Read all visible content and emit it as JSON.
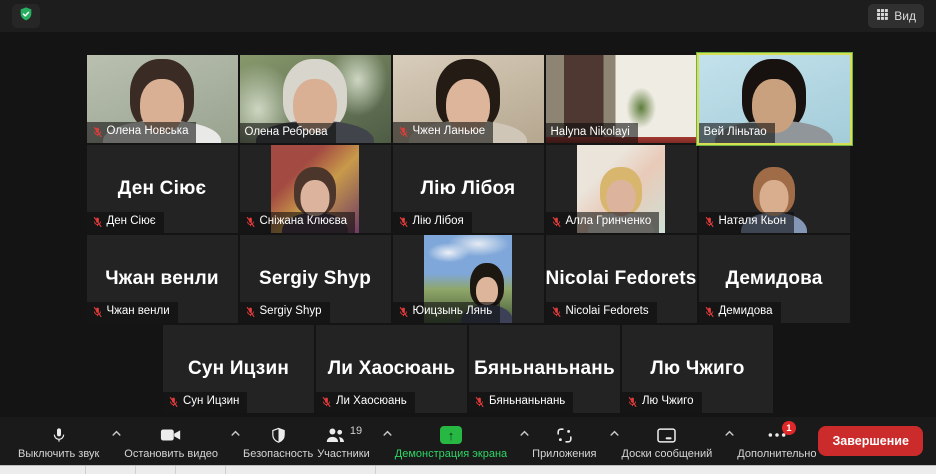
{
  "topbar": {
    "security_icon": "shield-check-icon",
    "view_label": "Вид"
  },
  "meeting": {
    "rows": [
      5,
      5,
      5,
      4
    ],
    "participants": [
      {
        "name": "Олена Новська",
        "tile": "video",
        "muted": true,
        "active": false,
        "variant": "plain",
        "person": "close",
        "colors": {
          "c1": "#b9c0b0",
          "c2": "#99a28f",
          "hair": "#3a2c24",
          "skin": "#d9b094",
          "shirt": "#e9e9e7"
        }
      },
      {
        "name": "Олена Реброва",
        "tile": "video",
        "muted": false,
        "active": false,
        "variant": "blur",
        "person": "close",
        "colors": {
          "c1": "#87996c",
          "c2": "#4e5c45",
          "c3": "#cdd6c2",
          "hair": "#d8d5cd",
          "skin": "#d9b094",
          "shirt": "#41454b"
        }
      },
      {
        "name": "Чжен Ланьюе",
        "tile": "video",
        "muted": true,
        "active": false,
        "variant": "plain",
        "person": "close",
        "colors": {
          "c1": "#d8cdbb",
          "c2": "#b5a78f",
          "hair": "#241b14",
          "skin": "#dcb59a",
          "shirt": "#cfc6b8"
        }
      },
      {
        "name": "Halyna Nikolayi",
        "tile": "video",
        "muted": false,
        "active": false,
        "variant": "room",
        "person": false,
        "colors": {
          "c1": "#8d8474",
          "c2": "#4e3831",
          "c3": "#efece3",
          "c4": "#5d7c3b"
        }
      },
      {
        "name": "Вей Ліньтао",
        "tile": "video",
        "muted": false,
        "active": true,
        "variant": "plain",
        "person": "close",
        "colors": {
          "c1": "#c3e2ec",
          "c2": "#a3ccd9",
          "hair": "#17120f",
          "skin": "#c9a17f",
          "shirt": "#90969a"
        }
      },
      {
        "name": "Ден Сіює",
        "tile": "text",
        "muted": true,
        "active": false
      },
      {
        "name": "Сніжана Клюєва",
        "tile": "photo",
        "muted": true,
        "active": false,
        "variant": "portrait",
        "person": "center",
        "colors": {
          "c1": "#a34a42",
          "c2": "#c89a4a",
          "c3": "#6e3b63",
          "hair": "#4c352a",
          "skin": "#dcb49d",
          "shirt": "#473747"
        }
      },
      {
        "name": "Лію Лібоя",
        "tile": "text",
        "muted": true,
        "active": false
      },
      {
        "name": "Алла Гринченко",
        "tile": "photo",
        "muted": true,
        "active": false,
        "variant": "portrait",
        "person": "center",
        "colors": {
          "c1": "#eae4da",
          "c2": "#e9cab8",
          "c3": "#cfe0d4",
          "hair": "#d9b66e",
          "skin": "#dcb49d",
          "shirt": "#e7e4dc"
        }
      },
      {
        "name": "Наталя Кьон",
        "tile": "photo",
        "muted": true,
        "active": false,
        "variant": "sea",
        "person": "center",
        "colors": {
          "c1": "#b9c0c6",
          "c2": "#95a0ab",
          "c3": "#55603f",
          "hair": "#a06c48",
          "skin": "#d9ae8e",
          "shirt": "#8396b5"
        }
      },
      {
        "name": "Чжан венли",
        "tile": "text",
        "muted": true,
        "active": false
      },
      {
        "name": "Sergiy Shyp",
        "tile": "text",
        "muted": true,
        "active": false
      },
      {
        "name": "Юицзынь Лянь",
        "tile": "photo",
        "muted": true,
        "active": false,
        "variant": "hills",
        "person": "right",
        "colors": {
          "c1": "#7fa7d9",
          "c2": "#8fa668",
          "c3": "#42593a",
          "hair": "#1d1712",
          "skin": "#dcb59a",
          "shirt": "#3c4157"
        }
      },
      {
        "name": "Nicolai Fedorets",
        "tile": "text",
        "muted": true,
        "active": false
      },
      {
        "name": "Демидова",
        "tile": "text",
        "muted": true,
        "active": false
      },
      {
        "name": "Сун Ицзин",
        "tile": "text",
        "muted": true,
        "active": false
      },
      {
        "name": "Ли Хаосюань",
        "tile": "text",
        "muted": true,
        "active": false
      },
      {
        "name": "Бяньнаньнань",
        "tile": "text",
        "muted": true,
        "active": false
      },
      {
        "name": "Лю Чжиго",
        "tile": "text",
        "muted": true,
        "active": false
      }
    ]
  },
  "toolbar": {
    "buttons": [
      {
        "id": "mute",
        "label": "Выключить звук",
        "icon": "microphone-icon",
        "chevron": true
      },
      {
        "id": "stop-video",
        "label": "Остановить видео",
        "icon": "video-camera-icon",
        "chevron": true
      },
      {
        "id": "security",
        "label": "Безопасность",
        "icon": "shield-icon",
        "chevron": false
      },
      {
        "id": "participants",
        "label": "Участники",
        "icon": "participants-icon",
        "chevron": true,
        "count": "19"
      },
      {
        "id": "share-screen",
        "label": "Демонстрация экрана",
        "icon": "share-screen-icon",
        "chevron": true,
        "accent": "green"
      },
      {
        "id": "apps",
        "label": "Приложения",
        "icon": "apps-icon",
        "chevron": true
      },
      {
        "id": "whiteboards",
        "label": "Доски сообщений",
        "icon": "whiteboard-icon",
        "chevron": true
      },
      {
        "id": "more",
        "label": "Дополнительно",
        "icon": "more-icon",
        "chevron": false,
        "alert": "1"
      }
    ],
    "end_button": "Завершение"
  },
  "colors": {
    "accent_green": "#2fd566",
    "share_green": "#26b843",
    "muted_red": "#e23b3b",
    "end_red": "#cc2b2b",
    "active_border_yellow": "#d6df55",
    "active_border_green": "#6fb244"
  }
}
